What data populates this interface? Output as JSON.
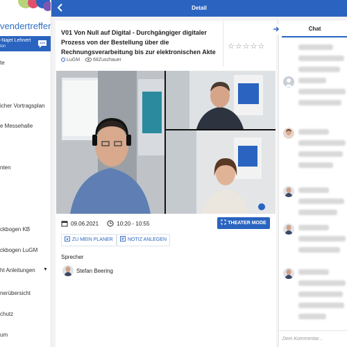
{
  "brand": {
    "name": "vendertreffen"
  },
  "user": {
    "name": "-Najet Lehnert",
    "subtitle": "ten"
  },
  "sidebar": {
    "items": [
      {
        "label": "te"
      },
      {
        "label": ""
      },
      {
        "label": "icher Vortragsplan"
      },
      {
        "label": "e Messehalle"
      },
      {
        "label": "nten"
      },
      {
        "label": "ckbogen KB"
      },
      {
        "label": "ckbogen LuGM"
      },
      {
        "label": "ht Anleitungen",
        "has_caret": true
      },
      {
        "label": "nerübersicht"
      },
      {
        "label": "chutz"
      },
      {
        "label": "um"
      }
    ]
  },
  "header": {
    "title": "Detail"
  },
  "session": {
    "title": "V01 Von Null auf Digital - Durchgängiger digitaler Prozess von der Bestellung über die Rechnungsverarbeitung bis zur elektronischen Akte",
    "rating_stars": "☆☆☆☆☆",
    "track": "LuGM",
    "viewers": "68Zuschauer",
    "date": "09.06.2021",
    "time": "10:20 - 10:55",
    "theater_label": "THEATER MODE",
    "planner_label": "ZU MEIN PLANER",
    "note_label": "NOTIZ ANLEGEN",
    "speakers_heading": "Sprecher",
    "speakers": [
      {
        "name": "Stefan Beering"
      }
    ]
  },
  "chat": {
    "tab_label": "Chat",
    "input_placeholder": "Dein Kommentar..."
  },
  "colors": {
    "accent": "#2a64c0",
    "background": "#f3f3f3"
  }
}
